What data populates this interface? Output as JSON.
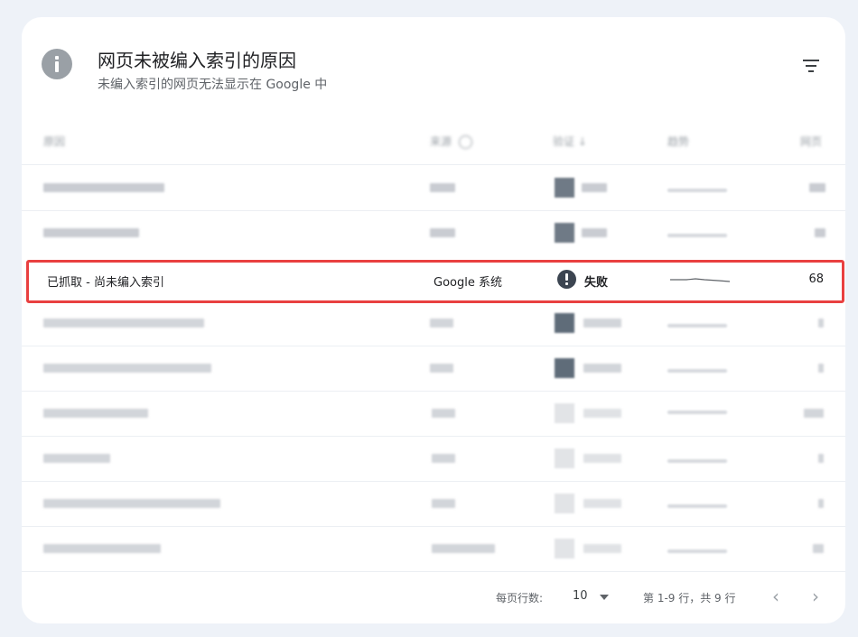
{
  "header": {
    "title": "网页未被编入索引的原因",
    "subtitle": "未编入索引的网页无法显示在 Google 中",
    "info_icon": "info-icon",
    "filter_icon": "filter-icon"
  },
  "columns": [
    "原因",
    "来源",
    "验证",
    "趋势",
    "网页"
  ],
  "highlighted_row": {
    "reason": "已抓取 - 尚未编入索引",
    "source": "Google 系统",
    "validation": "失败",
    "validation_icon": "error-icon",
    "pages": "68"
  },
  "footer": {
    "rows_per_page_label": "每页行数:",
    "rows_per_page_value": "10",
    "range_text": "第 1-9 行，共 9 行",
    "prev_icon": "chevron-left-icon",
    "next_icon": "chevron-right-icon"
  },
  "colors": {
    "highlight_border": "#e94040",
    "fail_icon": "#3c4551",
    "background": "#eef2f8"
  }
}
